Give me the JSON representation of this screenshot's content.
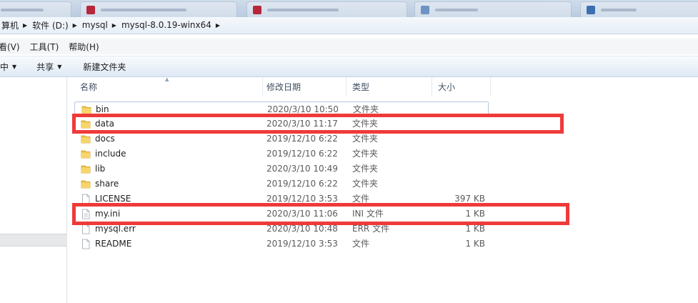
{
  "address": {
    "crumbs": [
      "算机",
      "软件 (D:)",
      "mysql",
      "mysql-8.0.19-winx64"
    ]
  },
  "menu": {
    "items": [
      "看(V)",
      "工具(T)",
      "帮助(H)"
    ]
  },
  "toolbar": {
    "include_label": "中",
    "share_label": "共享",
    "new_folder_label": "新建文件夹"
  },
  "columns": {
    "name": "名称",
    "date": "修改日期",
    "type": "类型",
    "size": "大小"
  },
  "files": [
    {
      "name": "bin",
      "date": "2020/3/10 10:50",
      "type": "文件夹",
      "size": "",
      "icon": "folder-icon"
    },
    {
      "name": "data",
      "date": "2020/3/10 11:17",
      "type": "文件夹",
      "size": "",
      "icon": "folder-icon"
    },
    {
      "name": "docs",
      "date": "2019/12/10 6:22",
      "type": "文件夹",
      "size": "",
      "icon": "folder-icon"
    },
    {
      "name": "include",
      "date": "2019/12/10 6:22",
      "type": "文件夹",
      "size": "",
      "icon": "folder-icon"
    },
    {
      "name": "lib",
      "date": "2020/3/10 10:49",
      "type": "文件夹",
      "size": "",
      "icon": "folder-icon"
    },
    {
      "name": "share",
      "date": "2019/12/10 6:22",
      "type": "文件夹",
      "size": "",
      "icon": "folder-icon"
    },
    {
      "name": "LICENSE",
      "date": "2019/12/10 3:53",
      "type": "文件",
      "size": "397 KB",
      "icon": "file-icon"
    },
    {
      "name": "my.ini",
      "date": "2020/3/10 11:06",
      "type": "INI 文件",
      "size": "1 KB",
      "icon": "file-icon"
    },
    {
      "name": "mysql.err",
      "date": "2020/3/10 10:48",
      "type": "ERR 文件",
      "size": "1 KB",
      "icon": "file-icon"
    },
    {
      "name": "README",
      "date": "2019/12/10 3:53",
      "type": "文件",
      "size": "1 KB",
      "icon": "file-icon"
    }
  ],
  "colors": {
    "highlight": "#ef3a3a",
    "folder": "#f0c447"
  }
}
